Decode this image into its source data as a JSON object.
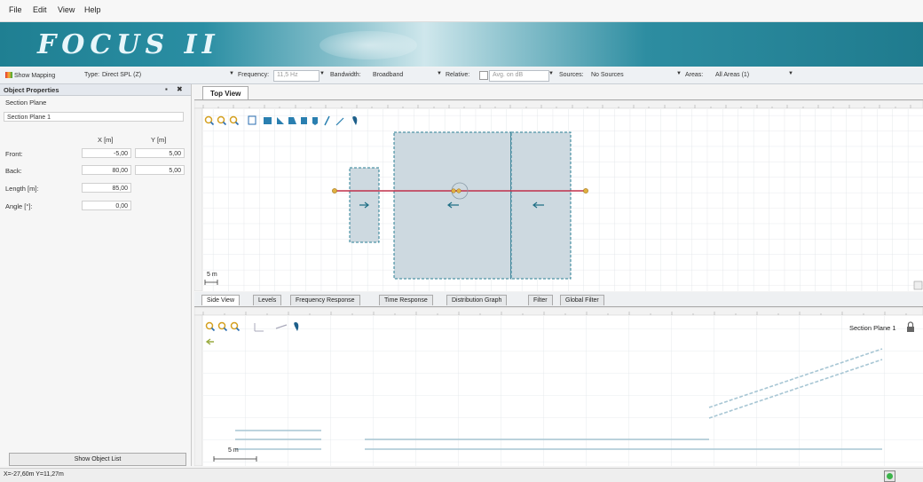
{
  "menu": {
    "items": [
      "File",
      "Edit",
      "View",
      "Help"
    ]
  },
  "banner": {
    "logo_text": "FOCUS II"
  },
  "toolbar": {
    "show_mapping": "Show Mapping",
    "type_label": "Type:",
    "type_value": "Direct SPL (Z)",
    "frequency_label": "Frequency:",
    "frequency_value": "11,5 Hz",
    "bandwidth_label": "Bandwidth:",
    "bandwidth_value": "Broadband",
    "relative_label": "Relative:",
    "relative_value": "Avg. on dB",
    "sources_label": "Sources:",
    "sources_value": "No Sources",
    "areas_label": "Areas:",
    "areas_value": "All Areas (1)"
  },
  "left_panel": {
    "title": "Object Properties",
    "pin_close": "&#x2716;",
    "section_label": "Section Plane",
    "section_name": "Section Plane 1",
    "col_x": "X [m]",
    "col_y": "Y [m]",
    "front_label": "Front:",
    "front_x": "-5,00",
    "front_y": "5,00",
    "back_label": "Back:",
    "back_x": "80,00",
    "back_y": "5,00",
    "length_label": "Length [m]:",
    "length_value": "85,00",
    "angle_label": "Angle [°]:",
    "angle_value": "0,00",
    "show_object_list": "Show Object List"
  },
  "top_view": {
    "tab": "Top View",
    "scale": "5 m"
  },
  "side_view": {
    "tabs": [
      "Side View",
      "Levels",
      "Frequency Response",
      "Time Response",
      "Distribution Graph",
      "Filter",
      "Global Filter"
    ],
    "section_name": "Section Plane 1",
    "scale": "5 m"
  },
  "status": {
    "coords": "X=-27,60m Y=11,27m"
  },
  "colors": {
    "banner": "#1f7f92",
    "grid": "#dfe3e7",
    "area_fill": "#cdd9e0",
    "area_stroke": "#2a7f95",
    "section_line": "#c0304a",
    "handle": "#e0b040"
  }
}
